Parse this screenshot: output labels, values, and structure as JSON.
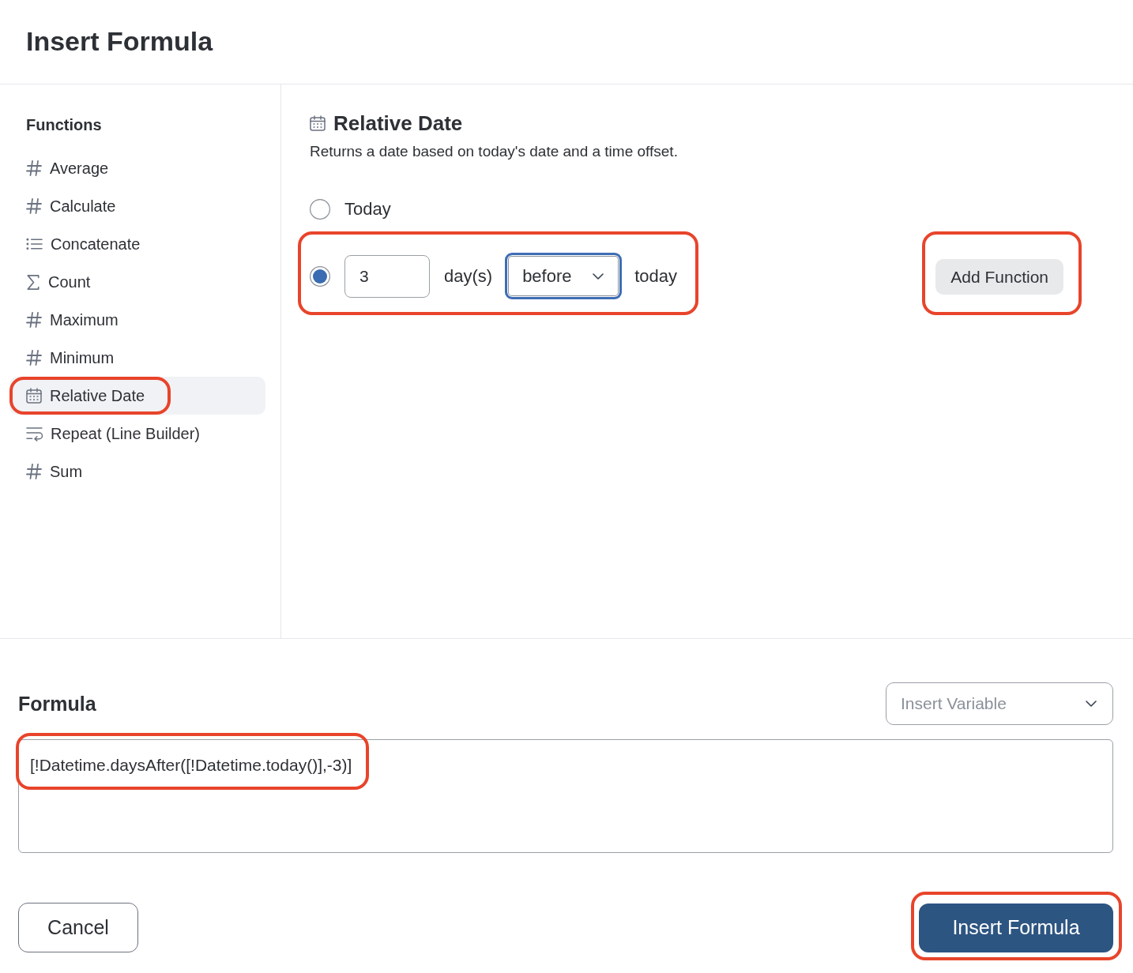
{
  "dialog": {
    "title": "Insert Formula"
  },
  "sidebar": {
    "heading": "Functions",
    "items": [
      {
        "label": "Average",
        "kind": "number",
        "selected": false,
        "highlighted": false
      },
      {
        "label": "Calculate",
        "kind": "number",
        "selected": false,
        "highlighted": false
      },
      {
        "label": "Concatenate",
        "kind": "list",
        "selected": false,
        "highlighted": false
      },
      {
        "label": "Count",
        "kind": "sum",
        "selected": false,
        "highlighted": false
      },
      {
        "label": "Maximum",
        "kind": "number",
        "selected": false,
        "highlighted": false
      },
      {
        "label": "Minimum",
        "kind": "number",
        "selected": false,
        "highlighted": false
      },
      {
        "label": "Relative Date",
        "kind": "date",
        "selected": true,
        "highlighted": true
      },
      {
        "label": "Repeat (Line Builder)",
        "kind": "repeat",
        "selected": false,
        "highlighted": false
      },
      {
        "label": "Sum",
        "kind": "number",
        "selected": false,
        "highlighted": false
      }
    ]
  },
  "function_panel": {
    "kind": "date",
    "title": "Relative Date",
    "description": "Returns a date based on today's date and a time offset.",
    "options": [
      {
        "kind": "plain",
        "label": "Today",
        "selected": false,
        "highlighted": false
      },
      {
        "kind": "offset",
        "selected": true,
        "highlighted": true,
        "amount": {
          "value": "3"
        },
        "unit": "day(s)",
        "direction": {
          "value": "before",
          "focused": true
        },
        "suffix": "today"
      }
    ],
    "add_button": {
      "label": "Add Function",
      "highlighted": true
    }
  },
  "formula": {
    "heading": "Formula",
    "insert_variable": {
      "placeholder": "Insert Variable"
    },
    "value": "[!Datetime.daysAfter([!Datetime.today()],-3)]",
    "highlighted": true
  },
  "buttons": [
    {
      "kind": "secondary",
      "label": "Cancel",
      "highlighted": false
    },
    {
      "kind": "primary",
      "label": "Insert Formula",
      "highlighted": true
    }
  ]
}
